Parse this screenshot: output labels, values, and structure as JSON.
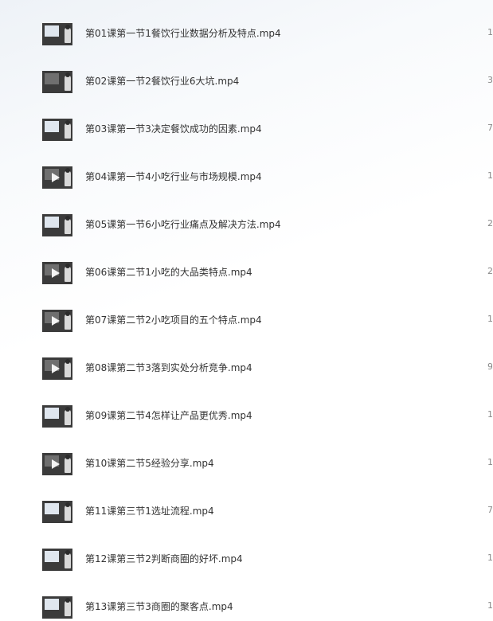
{
  "files": [
    {
      "name": "第01课第一节1餐饮行业数据分析及特点.mp4",
      "edge": "1",
      "thumb_icon": "video-thumbnail-icon",
      "play": false
    },
    {
      "name": "第02课第一节2餐饮行业6大坑.mp4",
      "edge": "3",
      "thumb_icon": "video-thumbnail-icon",
      "play": false
    },
    {
      "name": "第03课第一节3决定餐饮成功的因素.mp4",
      "edge": "7",
      "thumb_icon": "video-thumbnail-icon",
      "play": false
    },
    {
      "name": "第04课第一节4小吃行业与市场规模.mp4",
      "edge": "1",
      "thumb_icon": "play-icon",
      "play": true
    },
    {
      "name": "第05课第一节6小吃行业痛点及解决方法.mp4",
      "edge": "2",
      "thumb_icon": "video-thumbnail-icon",
      "play": false
    },
    {
      "name": "第06课第二节1小吃的大品类特点.mp4",
      "edge": "2",
      "thumb_icon": "play-icon",
      "play": true
    },
    {
      "name": "第07课第二节2小吃项目的五个特点.mp4",
      "edge": "1",
      "thumb_icon": "play-icon",
      "play": true
    },
    {
      "name": "第08课第二节3落到实处分析竞争.mp4",
      "edge": "9",
      "thumb_icon": "play-icon",
      "play": true
    },
    {
      "name": "第09课第二节4怎样让产品更优秀.mp4",
      "edge": "1",
      "thumb_icon": "video-thumbnail-icon",
      "play": false
    },
    {
      "name": "第10课第二节5经验分享.mp4",
      "edge": "1",
      "thumb_icon": "play-icon",
      "play": true
    },
    {
      "name": "第11课第三节1选址流程.mp4",
      "edge": "7",
      "thumb_icon": "video-thumbnail-icon",
      "play": false
    },
    {
      "name": "第12课第三节2判断商圈的好坏.mp4",
      "edge": "1",
      "thumb_icon": "video-thumbnail-icon",
      "play": false
    },
    {
      "name": "第13课第三节3商圈的聚客点.mp4",
      "edge": "1",
      "thumb_icon": "video-thumbnail-icon",
      "play": false
    }
  ]
}
